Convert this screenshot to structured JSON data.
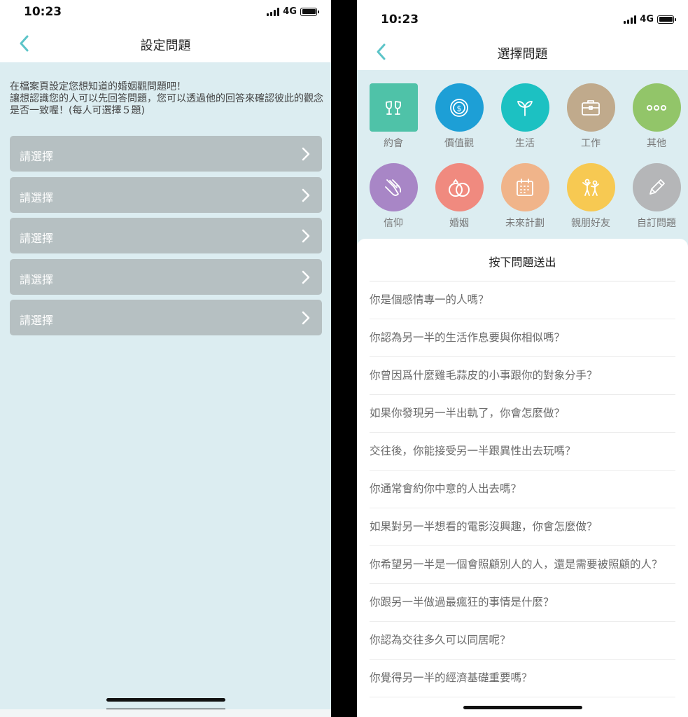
{
  "left": {
    "status": {
      "time": "10:23",
      "network": "4G"
    },
    "nav": {
      "title": "設定問題"
    },
    "intro": [
      "在檔案頁設定您想知道的婚姻觀問題吧！",
      "讓想認識您的人可以先回答問題，您可以透過他的回答來確認彼此的觀念是否一致喔！(每人可選擇５題)"
    ],
    "choices": [
      "請選擇",
      "請選擇",
      "請選擇",
      "請選擇",
      "請選擇"
    ]
  },
  "right": {
    "status": {
      "time": "10:23",
      "network": "4G"
    },
    "nav": {
      "title": "選擇問題"
    },
    "categories": [
      {
        "label": "約會",
        "icon": "wine-glasses-icon",
        "color": "#4fc2a8"
      },
      {
        "label": "價值觀",
        "icon": "coin-icon",
        "color": "#1d9fd6"
      },
      {
        "label": "生活",
        "icon": "sprout-icon",
        "color": "#1cc1c2"
      },
      {
        "label": "工作",
        "icon": "briefcase-icon",
        "color": "#c0aa8c"
      },
      {
        "label": "其他",
        "icon": "more-icon",
        "color": "#92c569"
      },
      {
        "label": "信仰",
        "icon": "praying-hands-icon",
        "color": "#a886c6"
      },
      {
        "label": "婚姻",
        "icon": "rings-icon",
        "color": "#f08a7f"
      },
      {
        "label": "未來計劃",
        "icon": "calendar-icon",
        "color": "#f0b48a"
      },
      {
        "label": "親朋好友",
        "icon": "friends-icon",
        "color": "#f7c952"
      },
      {
        "label": "自訂問題",
        "icon": "pencil-icon",
        "color": "#b5b6b8"
      }
    ],
    "sheet_title": "按下問題送出",
    "questions": [
      "你是個感情專一的人嗎？",
      "你認為另一半的生活作息要與你相似嗎？",
      "你曾因爲什麼雞毛蒜皮的小事跟你的對象分手？",
      "如果你發現另一半出軌了，你會怎麼做？",
      "交往後，你能接受另一半跟異性出去玩嗎？",
      "你通常會約你中意的人出去嗎？",
      "如果對另一半想看的電影沒興趣，你會怎麼做？",
      "你希望另一半是一個會照顧別人的人，還是需要被照顧的人？",
      "你跟另一半做過最瘋狂的事情是什麼？",
      "你認為交往多久可以同居呢？",
      "你覺得另一半的經濟基礎重要嗎？"
    ]
  },
  "colors": {
    "accent": "#5cc4c8",
    "background": "#dcedf1",
    "choice_button": "#b6c0c2"
  }
}
